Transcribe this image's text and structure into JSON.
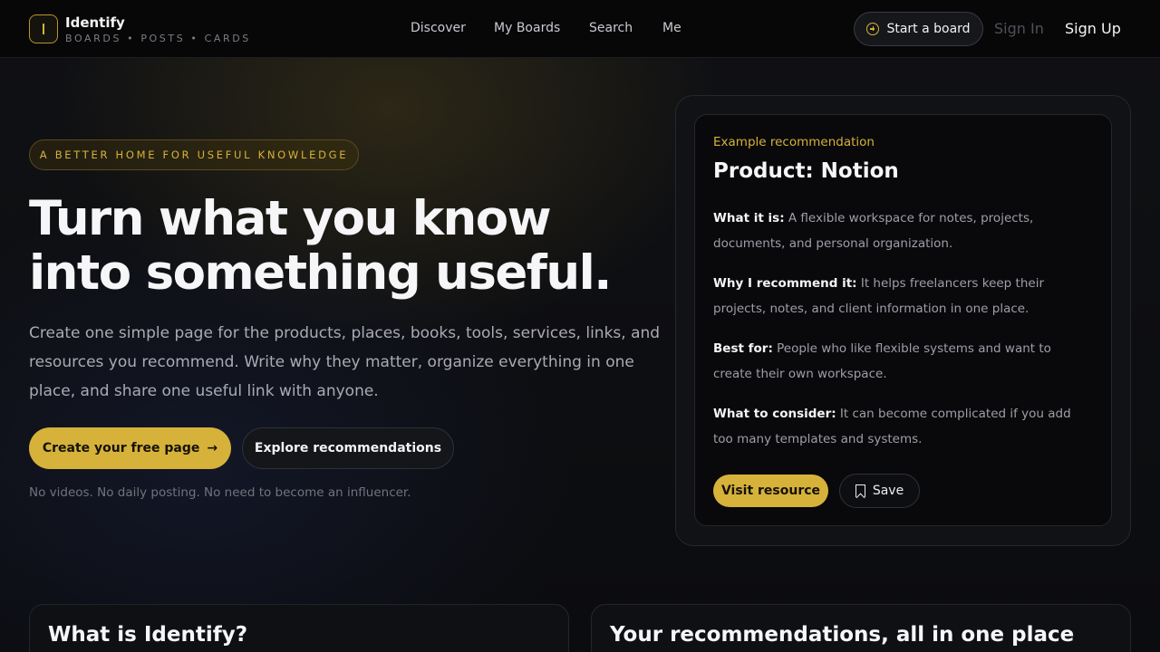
{
  "header": {
    "brand_name": "Identify",
    "brand_tagline": "BOARDS • POSTS • CARDS",
    "nav": [
      "Discover",
      "My Boards",
      "Search",
      "Me"
    ],
    "start_board_label": "Start a board",
    "sign_in_label": "Sign In",
    "sign_up_label": "Sign Up"
  },
  "hero": {
    "eyebrow": "A BETTER HOME FOR USEFUL KNOWLEDGE",
    "title_line1": "Turn what you know",
    "title_line2": "into something useful.",
    "description": "Create one simple page for the products, places, books, tools, services, links, and resources you recommend. Write why they matter, organize everything in one place, and share one useful link with anyone.",
    "primary_cta": "Create your free page",
    "secondary_cta": "Explore recommendations",
    "note": "No videos. No daily posting. No need to become an influencer."
  },
  "example_card": {
    "label": "Example recommendation",
    "title": "Product: Notion",
    "fields": [
      {
        "label": "What it is:",
        "text": "A flexible workspace for notes, projects, documents, and personal organization."
      },
      {
        "label": "Why I recommend it:",
        "text": "It helps freelancers keep their projects, notes, and client information in one place."
      },
      {
        "label": "Best for:",
        "text": "People who like flexible systems and want to create their own workspace."
      },
      {
        "label": "What to consider:",
        "text": "It can become complicated if you add too many templates and systems."
      }
    ],
    "visit_label": "Visit resource",
    "save_label": "Save"
  },
  "sections": {
    "left_title": "What is Identify?",
    "right_title": "Your recommendations, all in one place"
  },
  "colors": {
    "accent": "#d6b23a",
    "background": "#0b0c10"
  }
}
